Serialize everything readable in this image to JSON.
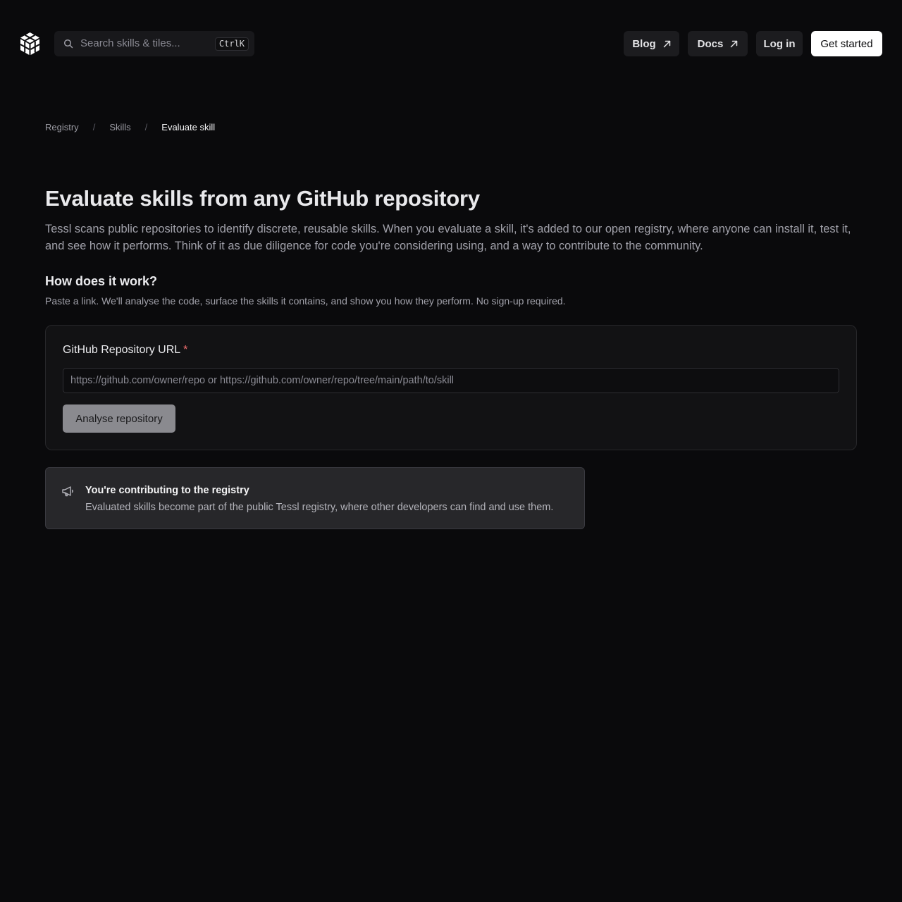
{
  "header": {
    "search_placeholder": "Search skills & tiles...",
    "search_shortcut": "CtrlK",
    "blog_label": "Blog",
    "docs_label": "Docs",
    "login_label": "Log in",
    "get_started_label": "Get started"
  },
  "breadcrumb": {
    "items": [
      "Registry",
      "Skills",
      "Evaluate skill"
    ],
    "separator": "/"
  },
  "main": {
    "title": "Evaluate skills from any GitHub repository",
    "intro": "Tessl scans public repositories to identify discrete, reusable skills. When you evaluate a skill, it's added to our open registry, where anyone can install it, test it, and see how it performs. Think of it as due diligence for code you're considering using, and a way to contribute to the community.",
    "how_title": "How does it work?",
    "how_text": "Paste a link. We'll analyse the code, surface the skills it contains, and show you how they perform. No sign-up required."
  },
  "form": {
    "label": "GitHub Repository URL",
    "required_marker": "*",
    "url_value": "",
    "url_placeholder": "https://github.com/owner/repo or https://github.com/owner/repo/tree/main/path/to/skill",
    "submit_label": "Analyse repository"
  },
  "notice": {
    "icon": "megaphone-icon",
    "title": "You're contributing to the registry",
    "text": "Evaluated skills become part of the public Tessl registry, where other developers can find and use them."
  },
  "colors": {
    "background": "#0a0a0c",
    "card": "#121214",
    "notice": "#27272a",
    "required": "#f87171",
    "primary_button": "#ffffff",
    "disabled_button": "#8a8a8f"
  }
}
